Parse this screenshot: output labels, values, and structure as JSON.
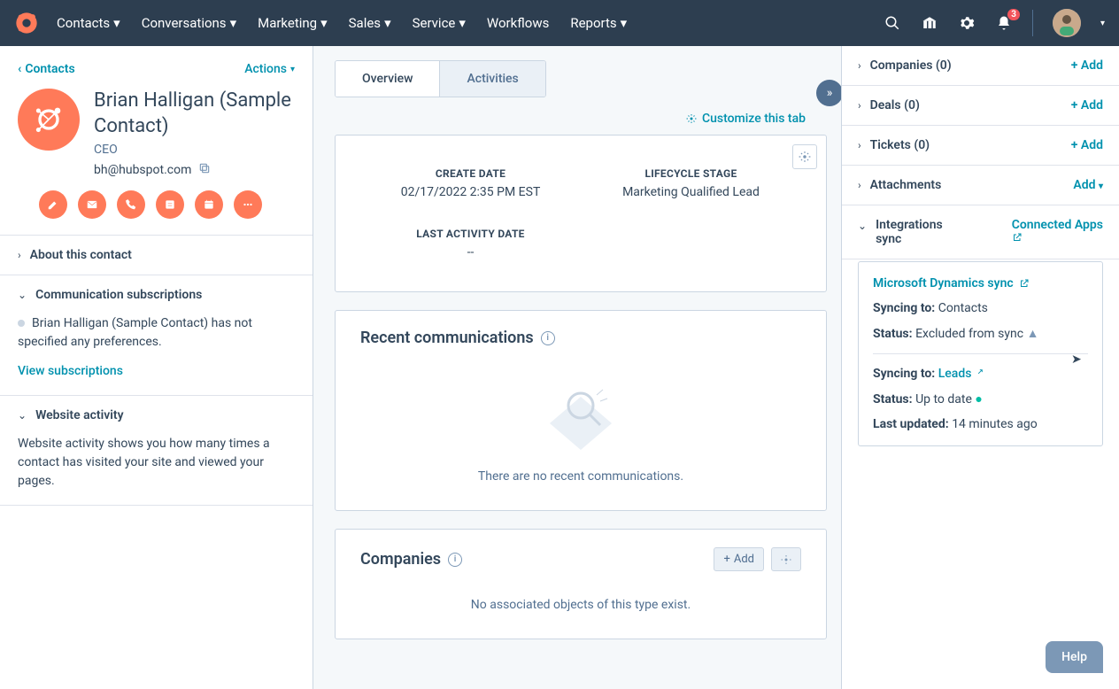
{
  "topbar": {
    "nav": [
      "Contacts",
      "Conversations",
      "Marketing",
      "Sales",
      "Service",
      "Workflows",
      "Reports"
    ],
    "notification_count": "3"
  },
  "left": {
    "back_link": "Contacts",
    "actions": "Actions",
    "name": "Brian Halligan (Sample Contact)",
    "title": "CEO",
    "email": "bh@hubspot.com",
    "sections": {
      "about": "About this contact",
      "comm_subs": "Communication subscriptions",
      "comm_body_prefix": "Brian Halligan (Sample Contact) has not specified any preferences.",
      "view_subs": "View subscriptions",
      "web_activity": "Website activity",
      "web_body": "Website activity shows you how many times a contact has visited your site and viewed your pages."
    }
  },
  "center": {
    "tabs": {
      "overview": "Overview",
      "activities": "Activities"
    },
    "customize": "Customize this tab",
    "stats": {
      "create_label": "CREATE DATE",
      "create_value": "02/17/2022 2:35 PM EST",
      "lifecycle_label": "LIFECYCLE STAGE",
      "lifecycle_value": "Marketing Qualified Lead",
      "last_activity_label": "LAST ACTIVITY DATE",
      "last_activity_value": "--"
    },
    "recent_title": "Recent communications",
    "recent_empty": "There are no recent communications.",
    "companies_title": "Companies",
    "companies_add": "Add",
    "companies_empty": "No associated objects of this type exist."
  },
  "right": {
    "rows": {
      "companies": "Companies (0)",
      "deals": "Deals (0)",
      "tickets": "Tickets (0)",
      "attachments": "Attachments",
      "integrations": "Integrations sync"
    },
    "add": "+ Add",
    "add_plain": "Add",
    "connected_apps": "Connected Apps",
    "integ": {
      "title": "Microsoft Dynamics sync",
      "sync1_label": "Syncing to:",
      "sync1_value": "Contacts",
      "status1_label": "Status:",
      "status1_value": "Excluded from sync",
      "sync2_label": "Syncing to:",
      "sync2_value": "Leads",
      "status2_label": "Status:",
      "status2_value": "Up to date",
      "updated_label": "Last updated:",
      "updated_value": "14 minutes ago"
    }
  },
  "help": "Help"
}
